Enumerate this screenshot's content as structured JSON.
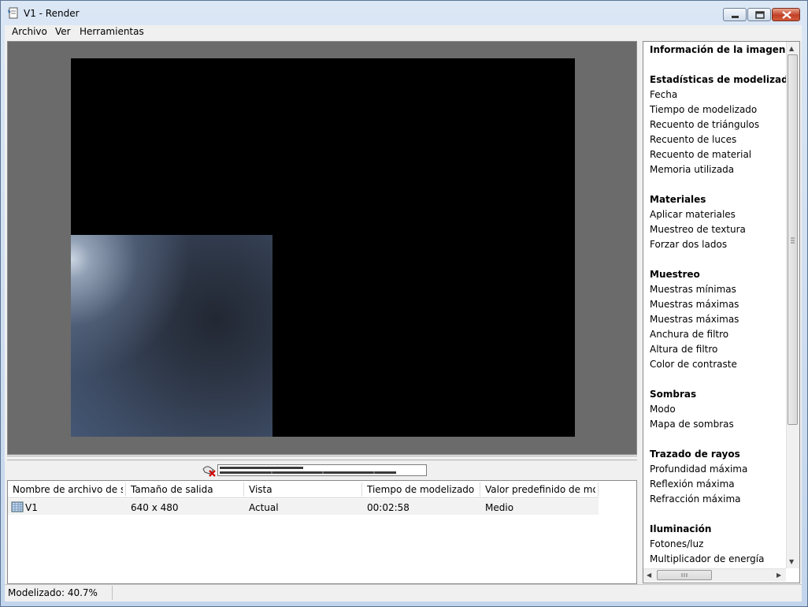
{
  "window": {
    "title": "V1 - Render"
  },
  "menu": {
    "items": [
      "Archivo",
      "Ver",
      "Herramientas"
    ]
  },
  "render": {
    "progress_percent": 40.7
  },
  "job_list": {
    "columns": [
      "Nombre de archivo de s...",
      "Tamaño de salida",
      "Vista",
      "Tiempo de modelizado",
      "Valor predefinido de mo..."
    ],
    "rows": [
      {
        "name": "V1",
        "size": "640 x 480",
        "view": "Actual",
        "time": "00:02:58",
        "preset": "Medio"
      }
    ]
  },
  "info_panel": {
    "title": "Información de la imagen",
    "sections": [
      {
        "header": "Estadísticas de modelizado",
        "items": [
          "Fecha",
          "Tiempo de modelizado",
          "Recuento de triángulos",
          "Recuento de luces",
          "Recuento de material",
          "Memoria utilizada"
        ]
      },
      {
        "header": "Materiales",
        "items": [
          "Aplicar materiales",
          "Muestreo de textura",
          "Forzar dos lados"
        ]
      },
      {
        "header": "Muestreo",
        "items": [
          "Muestras mínimas",
          "Muestras máximas",
          "Muestras máximas",
          "Anchura de filtro",
          "Altura de filtro",
          "Color de contraste"
        ]
      },
      {
        "header": "Sombras",
        "items": [
          "Modo",
          "Mapa de sombras"
        ]
      },
      {
        "header": "Trazado de rayos",
        "items": [
          "Profundidad máxima",
          "Reflexión máxima",
          "Refracción máxima"
        ]
      },
      {
        "header": "Iluminación",
        "items": [
          "Fotones/luz",
          "Multiplicador de energía"
        ]
      }
    ]
  },
  "status": {
    "text": "Modelizado: 40.7%"
  },
  "colors": {
    "accent": "#3d4c66",
    "title_gradient_top": "#dbe7f5",
    "close_button": "#c24027"
  }
}
